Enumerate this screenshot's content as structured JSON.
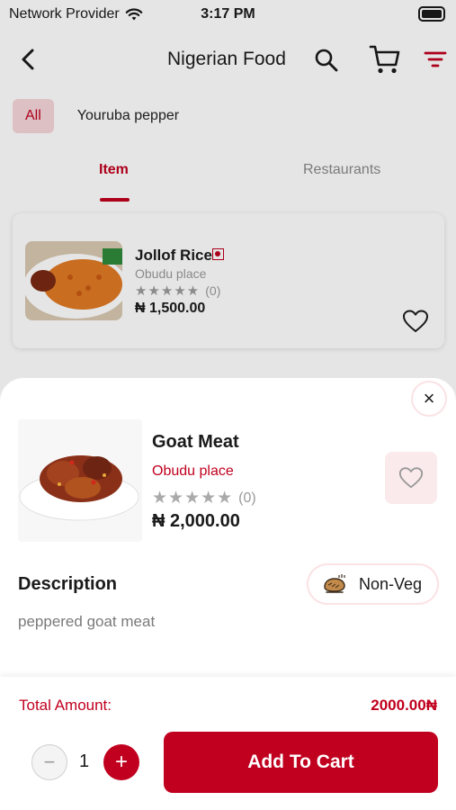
{
  "status_bar": {
    "carrier": "Network Provider",
    "time": "3:17 PM"
  },
  "header": {
    "title": "Nigerian Food"
  },
  "chips": {
    "all": "All",
    "second": "Youruba pepper"
  },
  "tabs": {
    "item": "Item",
    "restaurants": "Restaurants"
  },
  "list_card": {
    "name": "Jollof Rice",
    "place": "Obudu place",
    "stars": "★★★★★",
    "reviews": "(0)",
    "price": "₦ 1,500.00"
  },
  "sheet": {
    "name": "Goat Meat",
    "place": "Obudu place",
    "stars": "★★★★★",
    "reviews": "(0)",
    "price": "₦ 2,000.00",
    "description_title": "Description",
    "description": "peppered goat meat",
    "diet_label": "Non-Veg"
  },
  "footer": {
    "total_label": "Total Amount:",
    "total_value": "2000.00₦",
    "quantity": "1",
    "add_to_cart": "Add To Cart"
  },
  "colors": {
    "accent": "#c0001e",
    "accent_soft": "#fbeaec"
  }
}
